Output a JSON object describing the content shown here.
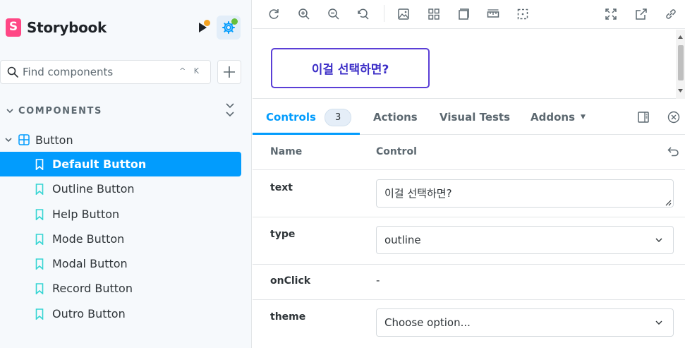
{
  "sidebar": {
    "brand": {
      "letter": "S",
      "name": "Storybook"
    },
    "search": {
      "placeholder": "Find components",
      "shortcut": "^ K"
    },
    "section": "COMPONENTS",
    "group": {
      "label": "Button"
    },
    "items": [
      {
        "label": "Default Button",
        "selected": true
      },
      {
        "label": "Outline Button"
      },
      {
        "label": "Help Button"
      },
      {
        "label": "Mode Button"
      },
      {
        "label": "Modal Button"
      },
      {
        "label": "Record Button"
      },
      {
        "label": "Outro Button"
      }
    ]
  },
  "preview": {
    "button_text": "이걸 선택하면?"
  },
  "addons": {
    "tabs": [
      {
        "label": "Controls",
        "badge": "3",
        "active": true
      },
      {
        "label": "Actions"
      },
      {
        "label": "Visual Tests"
      },
      {
        "label": "Addons"
      }
    ],
    "header": {
      "name": "Name",
      "control": "Control"
    },
    "rows": [
      {
        "name": "text",
        "value": "이걸 선택하면?"
      },
      {
        "name": "type",
        "value": "outline"
      },
      {
        "name": "onClick",
        "value": "-"
      },
      {
        "name": "theme",
        "value": "Choose option..."
      }
    ]
  },
  "colors": {
    "accent": "#029cfd",
    "brand": "#ff4785",
    "preview_button": "#5b3fd6"
  },
  "icons": [
    "storybook-logo",
    "play-icon",
    "settings-icon",
    "search-icon",
    "plus-icon",
    "chevron-down-icon",
    "collapse-all-icon",
    "component-icon",
    "bookmark-icon",
    "reload-icon",
    "zoom-in-icon",
    "zoom-out-icon",
    "zoom-reset-icon",
    "background-icon",
    "grid-icon",
    "viewport-icon",
    "measure-icon",
    "outline-icon",
    "fullscreen-icon",
    "open-new-icon",
    "link-icon",
    "sidebar-right-icon",
    "close-icon",
    "undo-icon"
  ]
}
